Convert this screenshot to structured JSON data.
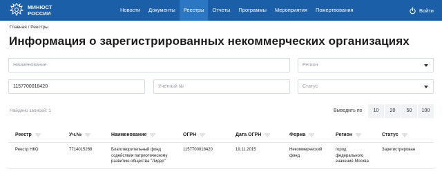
{
  "header": {
    "logo_line1": "МИНЮСТ",
    "logo_line2": "РОССИИ",
    "nav": [
      "Новости",
      "Документы",
      "Реестры",
      "Отчеты",
      "Программы",
      "Мероприятия",
      "Пожертвования"
    ],
    "active_nav": "Реестры",
    "login_label": "Войти"
  },
  "breadcrumb": {
    "home": "Главная",
    "separator": "/",
    "current": "Реестры"
  },
  "page_title": "Информация о зарегистрированных некоммерческих организациях",
  "filters": {
    "name_placeholder": "Наименование",
    "region_placeholder": "Регион",
    "ogrn_value": "1157700018420",
    "accounting_placeholder": "Учетный №",
    "status_placeholder": "Статус"
  },
  "results": {
    "found_label": "Найдено записей: 1",
    "per_page_label": "Выводить по",
    "per_page_options": [
      "10",
      "20",
      "50",
      "100"
    ]
  },
  "table": {
    "columns": [
      "Реестр",
      "Уч.№",
      "Наименование",
      "ОГРН",
      "Дата ОГРН",
      "Форма",
      "Регион",
      "Статус"
    ],
    "rows": [
      {
        "registry": "Реестр НКО",
        "acc_no": "7714015268",
        "name_l1": "Благотворительный фонд",
        "name_l2": "содействия патриотическому",
        "name_l3": "развитию общества \"Лидер\"",
        "ogrn": "1157700018420",
        "ogrn_date": "19.11.2015",
        "form_l1": "Некоммерческий",
        "form_l2": "фонд",
        "region_l1": "город",
        "region_l2": "федерального",
        "region_l3": "значения Москва",
        "status": "Зарегистрирован"
      }
    ]
  },
  "colors": {
    "header_bg": "#1a5fa8",
    "active_nav_bg": "#2b77c4"
  }
}
